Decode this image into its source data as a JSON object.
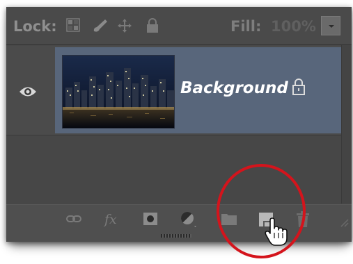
{
  "lock_bar": {
    "lock_label": "Lock:",
    "fill_label": "Fill:",
    "fill_value": "100%",
    "icons": [
      "lock-transparent-pixels-icon",
      "lock-image-pixels-icon",
      "lock-position-icon",
      "lock-all-icon"
    ]
  },
  "layer": {
    "name": "Background",
    "visible": true,
    "locked": true,
    "icons": [
      "eye-icon",
      "lock-icon"
    ]
  },
  "bottom_toolbar": {
    "icons": [
      "link-layers-icon",
      "layer-style-fx-icon",
      "add-mask-icon",
      "adjustment-layer-icon",
      "group-folder-icon",
      "new-layer-icon",
      "trash-icon"
    ]
  },
  "colors": {
    "panel_bg": "#484848",
    "selected_row": "#58667b",
    "highlight_circle": "#d4141c"
  }
}
